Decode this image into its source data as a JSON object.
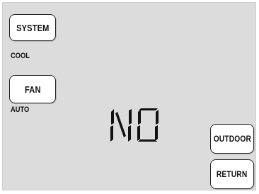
{
  "thermostat": {
    "system_button": "SYSTEM",
    "system_mode": "COOL",
    "fan_button": "FAN",
    "fan_mode": "AUTO",
    "display_text": "NO",
    "outdoor_button": "OUTDOOR",
    "return_button": "RETURN"
  }
}
